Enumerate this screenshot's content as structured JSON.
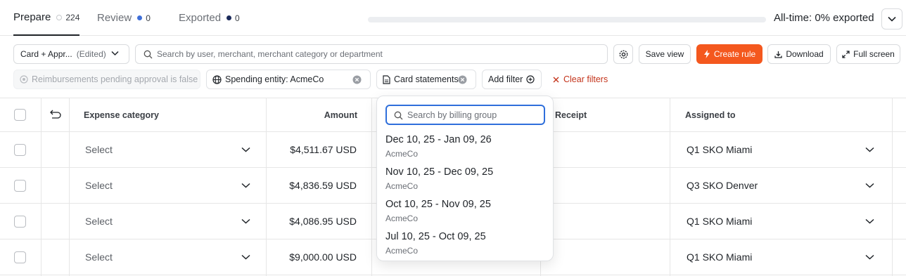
{
  "tabs": [
    {
      "label": "Prepare",
      "count": "224",
      "active": true
    },
    {
      "label": "Review",
      "count": "0",
      "dot_color": "#3f6fd8"
    },
    {
      "label": "Exported",
      "count": "0",
      "dot_color": "#1b2a5a"
    }
  ],
  "export_status": {
    "label": "All-time: 0% exported",
    "progress_fraction": 0
  },
  "toolbar": {
    "view_name": "Card + Appr...",
    "view_edited": "(Edited)",
    "search_placeholder": "Search by user, merchant, merchant category or department",
    "save_view": "Save view",
    "create_rule": "Create rule",
    "download": "Download",
    "full_screen": "Full screen"
  },
  "filters": {
    "reimbursements": "Reimbursements pending approval is false",
    "spending_entity": "Spending entity: AcmeCo",
    "card_statements": "Card statements",
    "add_filter": "Add filter",
    "clear_filters": "Clear filters"
  },
  "table": {
    "headers": {
      "expense_category": "Expense category",
      "amount": "Amount",
      "receipt": "Receipt",
      "assigned_to": "Assigned to"
    },
    "rows": [
      {
        "category": "Select",
        "amount": "$4,511.67 USD",
        "assigned": "Q1 SKO Miami"
      },
      {
        "category": "Select",
        "amount": "$4,836.59 USD",
        "assigned": "Q3 SKO Denver"
      },
      {
        "category": "Select",
        "amount": "$4,086.95 USD",
        "assigned": "Q1 SKO Miami"
      },
      {
        "category": "Select",
        "amount": "$9,000.00 USD",
        "assigned": "Q1 SKO Miami"
      }
    ]
  },
  "dropdown": {
    "search_placeholder": "Search by billing group",
    "items": [
      {
        "title": "Dec 10, 25 - Jan 09, 26",
        "sub": "AcmeCo"
      },
      {
        "title": "Nov 10, 25 - Dec 09, 25",
        "sub": "AcmeCo"
      },
      {
        "title": "Oct 10, 25 - Nov 09, 25",
        "sub": "AcmeCo"
      },
      {
        "title": "Jul 10, 25 - Oct 09, 25",
        "sub": "AcmeCo"
      }
    ]
  },
  "colors": {
    "accent": "#f4581e",
    "focus": "#2f6fdb",
    "danger": "#c4341b"
  }
}
